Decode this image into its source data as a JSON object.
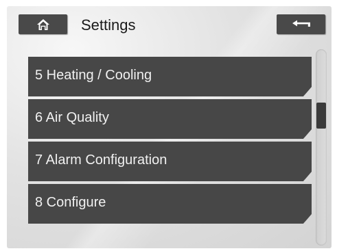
{
  "header": {
    "title": "Settings",
    "home_icon": "home-icon",
    "back_icon": "back-arrow-icon"
  },
  "menu": {
    "items": [
      {
        "label": "5 Heating / Cooling"
      },
      {
        "label": "6 Air Quality"
      },
      {
        "label": "7 Alarm Configuration"
      },
      {
        "label": "8 Configure"
      }
    ]
  },
  "scrollbar": {
    "position": 0.4
  },
  "colors": {
    "button_bg": "#474747",
    "button_text": "#f1f1f1",
    "screen_bg": "#dedede",
    "title_text": "#1a1a1a"
  }
}
